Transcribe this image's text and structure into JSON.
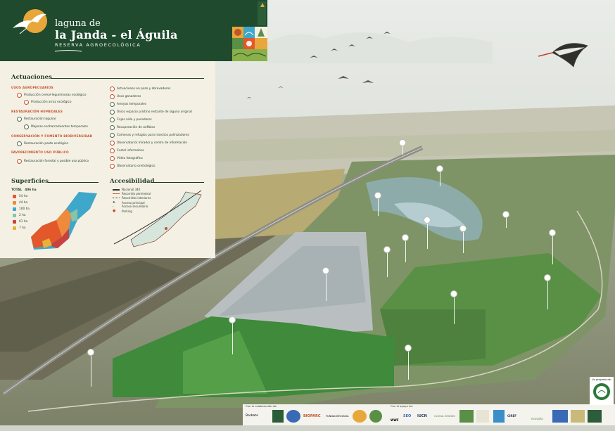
{
  "header": {
    "title_line1": "laguna de",
    "title_line2": "la Janda - el Águila",
    "subtitle": "RESERVA AGROECOLÓGICA"
  },
  "actuaciones": {
    "title": "Actuaciones",
    "left": [
      {
        "type": "category",
        "text": "USOS AGROPECUARIOS"
      },
      {
        "type": "item",
        "icon": "wheat-icon",
        "text": "Producción cereal-leguminosas ecológico"
      },
      {
        "type": "item",
        "icon": "rice-icon",
        "text": "Producción arroz ecológico"
      },
      {
        "type": "category",
        "text": "RESTAURACIÓN HUMEDALES"
      },
      {
        "type": "item",
        "icon": "lagoon-icon",
        "text": "Restauración lagunar"
      },
      {
        "type": "item",
        "icon": "grass-icon",
        "text": "Mejoras encharcamientos temporales"
      },
      {
        "type": "category",
        "text": "CONSERVACIÓN Y FOMENTO BIODIVERSIDAD"
      },
      {
        "type": "item",
        "icon": "pasture-icon",
        "text": "Restauración pasto ecológico"
      },
      {
        "type": "category",
        "text": "FAVORECIMIENTO USO PÚBLICO"
      },
      {
        "type": "item",
        "icon": "tree-icon",
        "text": "Restauración forestal y posible uso público"
      }
    ],
    "right": [
      {
        "icon": "well-icon",
        "text": "Actuaciones en pozo y abrevaderos"
      },
      {
        "icon": "cattle-icon",
        "text": "Usos ganaderos"
      },
      {
        "icon": "stream-icon",
        "text": "Arroyos temporales"
      },
      {
        "icon": "lagoon-icon",
        "text": "Único espacio prístino restante de laguna original"
      },
      {
        "icon": "nestbox-icon",
        "text": "Cajas nido y posaderos"
      },
      {
        "icon": "amphibian-icon",
        "text": "Recuperación de anfibios"
      },
      {
        "icon": "insect-icon",
        "text": "Cúmenas y refugios para insectos polinizadores"
      },
      {
        "icon": "observatory-icon",
        "text": "Observatorio/ mirador y centro de información"
      },
      {
        "icon": "info-icon",
        "text": "Cartel informativo"
      },
      {
        "icon": "camera-icon",
        "text": "Vídeo fotográfico"
      },
      {
        "icon": "binoculars-icon",
        "text": "Observatorio ornitológico"
      }
    ]
  },
  "superficies": {
    "title": "Superficies",
    "total_label": "TOTAL",
    "total_value": "406 ha",
    "rows": [
      {
        "icon": "wheat-icon",
        "value": "54 ha",
        "color": "#e2582b"
      },
      {
        "icon": "rice-icon",
        "value": "44 ha",
        "color": "#ef8a3c"
      },
      {
        "icon": "lagoon-icon",
        "value": "100 ha",
        "color": "#3fa7c9"
      },
      {
        "icon": "grass-icon",
        "value": "2 ha",
        "color": "#89c3a8"
      },
      {
        "icon": "pasture-icon",
        "value": "61 ha",
        "color": "#c9423f"
      },
      {
        "icon": "tree-icon",
        "value": "7 ha",
        "color": "#e7b13a"
      }
    ]
  },
  "accesibilidad": {
    "title": "Accesibilidad",
    "rows": [
      {
        "text": "Nacional 340",
        "style": "road"
      },
      {
        "text": "Recorrido perimetral",
        "style": "perimeter"
      },
      {
        "text": "Recorridos interiores",
        "style": "interior"
      },
      {
        "text": "Acceso principal",
        "style": "arrow"
      },
      {
        "text": "Acceso secundario",
        "style": "arrow-small"
      },
      {
        "text": "Parking",
        "style": "parking"
      }
    ]
  },
  "footer": {
    "label_colaboracion": "Con la colaboración de:",
    "label_apoyo": "Con el apoyo de:",
    "logos": [
      "Barbate",
      "BIOPARC",
      "FUNDACIÓN SAVIA",
      "WWF",
      "SEO",
      "IUCN",
      "GLOBAL BIRDING",
      "CIREF",
      "ecovalia"
    ],
    "seal_label": "Un proyecto de:"
  },
  "colors": {
    "header_bg": "#1f4a2e",
    "panel_bg": "#f5f0e4",
    "accent_orange": "#c0542c",
    "wetland_blue": "#3fa7c9"
  }
}
